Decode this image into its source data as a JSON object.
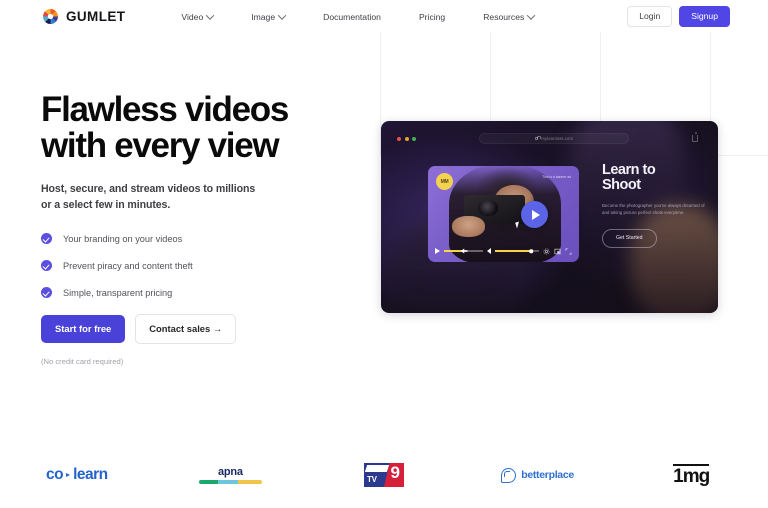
{
  "brand": {
    "name": "GUMLET",
    "logo_icon": "gumlet-pinwheel-icon"
  },
  "nav": {
    "links": [
      {
        "label": "Video",
        "has_caret": true
      },
      {
        "label": "Image",
        "has_caret": true
      },
      {
        "label": "Documentation",
        "has_caret": false
      },
      {
        "label": "Pricing",
        "has_caret": false
      },
      {
        "label": "Resources",
        "has_caret": true
      }
    ],
    "login_label": "Login",
    "signup_label": "Signup"
  },
  "hero": {
    "title_line1": "Flawless videos",
    "title_line2": "with every view",
    "subtitle_line1": "Host, secure, and stream videos to millions",
    "subtitle_line2": "or a select few in minutes.",
    "features": [
      "Your branding on your videos",
      "Prevent piracy and content theft",
      "Simple, transparent pricing"
    ],
    "primary_cta": "Start for free",
    "secondary_cta": "Contact sales →",
    "fineprint": "(No credit card required)"
  },
  "mockup": {
    "url": "mylearnsss.com",
    "badge_text": "MM",
    "video_tag": "This is a banner ad",
    "headline_line1": "Learn to",
    "headline_line2": "Shoot",
    "body": "Become the photographer you've always dreamed of and taking picture perfect shots everytime.",
    "cta": "Get Started"
  },
  "logos": [
    {
      "name": "co-learn",
      "part1": "co",
      "part2": "learn"
    },
    {
      "name": "apna",
      "text": "apna"
    },
    {
      "name": "tv9",
      "text": "TV",
      "number": "9"
    },
    {
      "name": "betterplace",
      "text": "betterplace"
    },
    {
      "name": "1mg",
      "text": "1mg"
    }
  ],
  "colors": {
    "accent_indigo": "#4f46e5",
    "check_purple": "#5b4ee0",
    "progress_yellow": "#f5d44c",
    "heading_black": "#0a0a0b"
  }
}
